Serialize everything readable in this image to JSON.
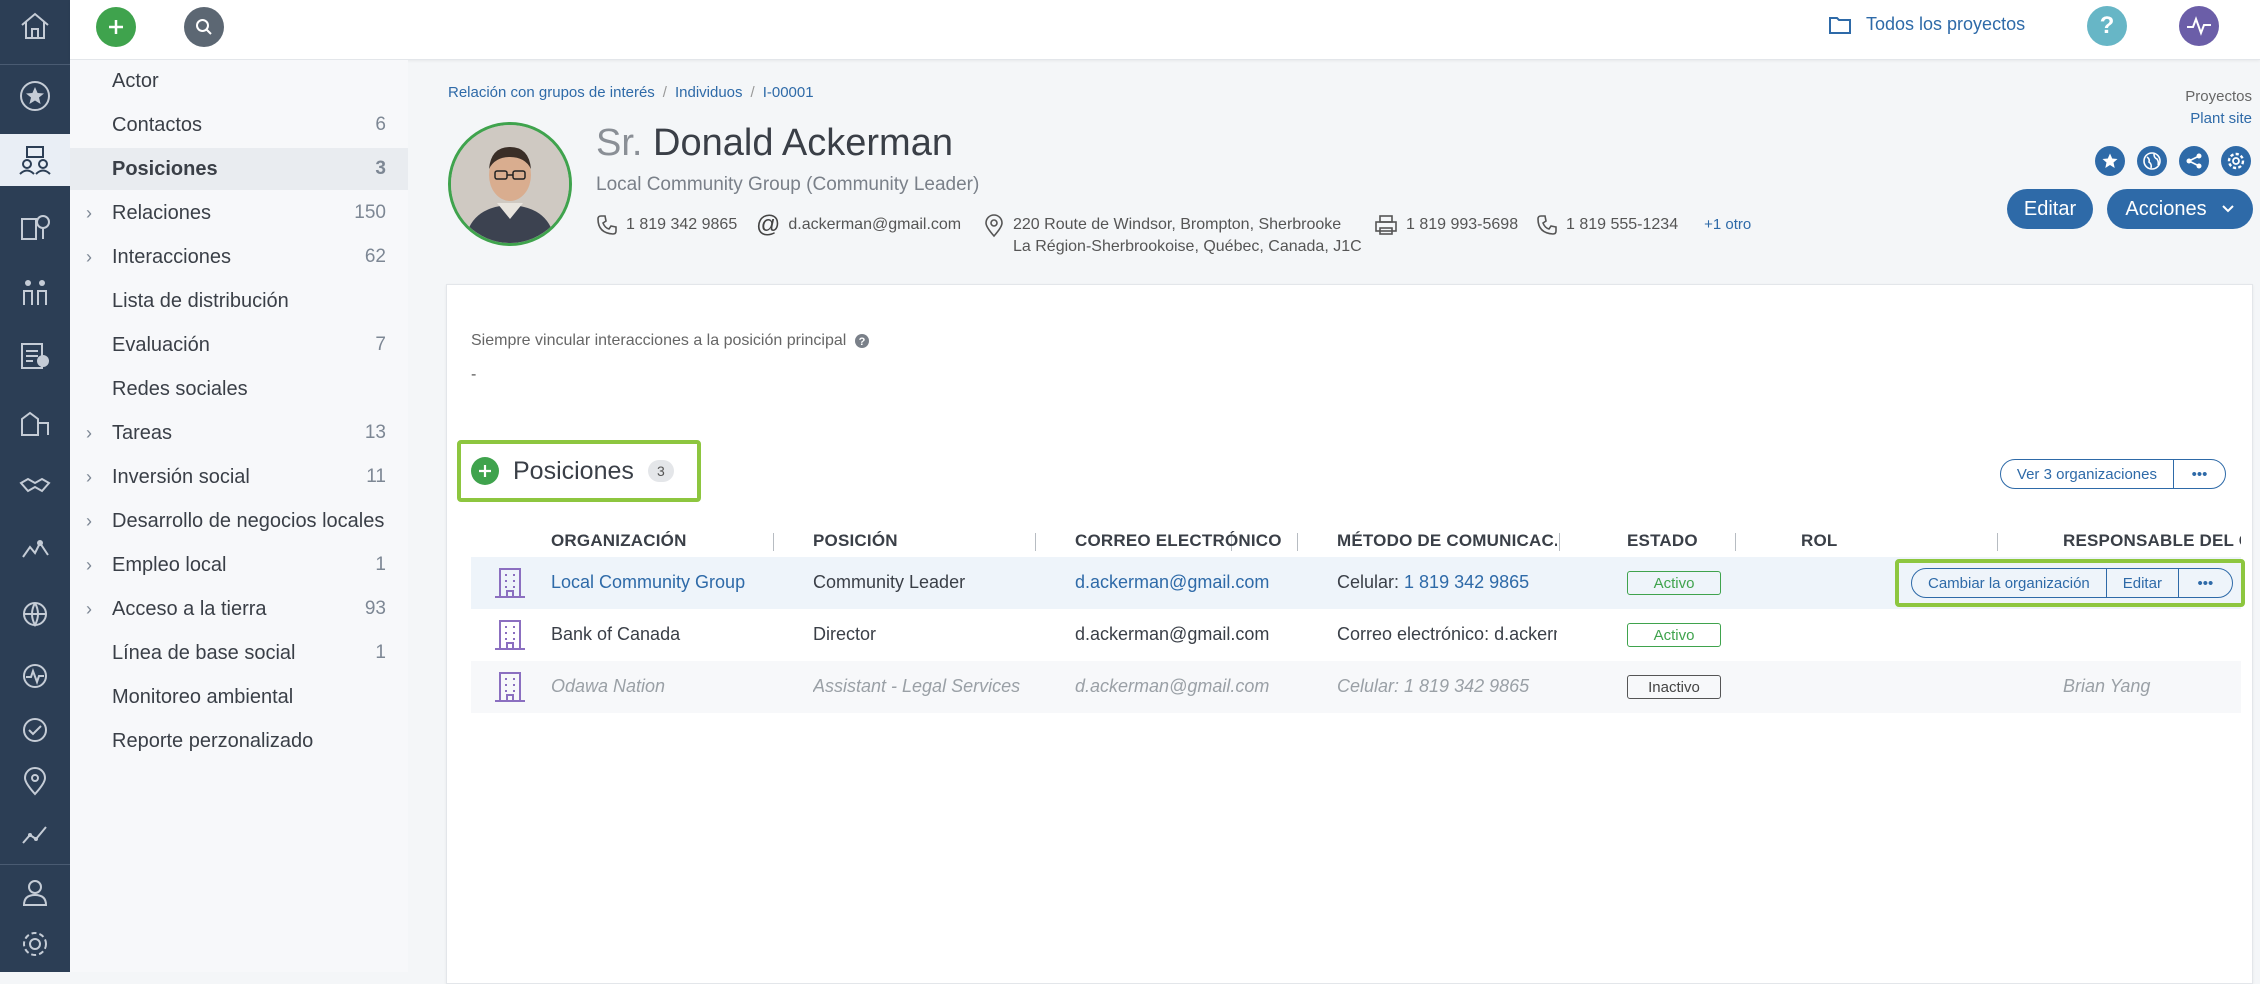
{
  "topbar": {
    "projects_label": "Todos los proyectos",
    "help_label": "?"
  },
  "leftnav": {
    "items": [
      {
        "label": "Actor",
        "count": "",
        "chevron": false,
        "active": false
      },
      {
        "label": "Contactos",
        "count": "6",
        "chevron": false,
        "active": false
      },
      {
        "label": "Posiciones",
        "count": "3",
        "chevron": false,
        "active": true
      },
      {
        "label": "Relaciones",
        "count": "150",
        "chevron": true,
        "active": false
      },
      {
        "label": "Interacciones",
        "count": "62",
        "chevron": true,
        "active": false
      },
      {
        "label": "Lista de distribución",
        "count": "",
        "chevron": false,
        "active": false
      },
      {
        "label": "Evaluación",
        "count": "7",
        "chevron": false,
        "active": false
      },
      {
        "label": "Redes sociales",
        "count": "",
        "chevron": false,
        "active": false
      },
      {
        "label": "Tareas",
        "count": "13",
        "chevron": true,
        "active": false
      },
      {
        "label": "Inversión social",
        "count": "11",
        "chevron": true,
        "active": false
      },
      {
        "label": "Desarrollo de negocios locales",
        "count": "",
        "chevron": true,
        "active": false
      },
      {
        "label": "Empleo local",
        "count": "1",
        "chevron": true,
        "active": false
      },
      {
        "label": "Acceso a la tierra",
        "count": "93",
        "chevron": true,
        "active": false
      },
      {
        "label": "Línea de base social",
        "count": "1",
        "chevron": false,
        "active": false
      },
      {
        "label": "Monitoreo ambiental",
        "count": "",
        "chevron": false,
        "active": false
      },
      {
        "label": "Reporte perzonalizado",
        "count": "",
        "chevron": false,
        "active": false
      }
    ]
  },
  "breadcrumb": {
    "items": [
      "Relación con grupos de interés",
      "Individuos",
      "I-00001"
    ]
  },
  "project": {
    "label": "Proyectos",
    "value": "Plant site"
  },
  "profile": {
    "honorific": "Sr.",
    "name": "Donald Ackerman",
    "subtitle": "Local Community Group (Community Leader)",
    "phone": "1 819 342 9865",
    "email": "d.ackerman@gmail.com",
    "address_line1": "220 Route de Windsor, Brompton, Sherbrooke",
    "address_line2": "La Région-Sherbrookoise, Québec, Canada, J1C",
    "fax": "1 819 993-5698",
    "phone2": "1 819 555-1234",
    "more": "+1 otro"
  },
  "actions": {
    "edit_label": "Editar",
    "actions_label": "Acciones"
  },
  "setting": {
    "label": "Siempre vincular interacciones a la posición principal",
    "value": "-"
  },
  "positions": {
    "title": "Posiciones",
    "count": "3",
    "view_orgs_label": "Ver 3 organizaciones",
    "more_label": "•••",
    "columns": [
      "ORGANIZACIÓN",
      "POSICIÓN",
      "CORREO ELECTRÓNICO",
      "MÉTODO DE COMUNICAC...",
      "ESTADO",
      "ROL",
      "RESPONSABLE DEL CO"
    ],
    "rows": [
      {
        "org": "Local Community Group",
        "position": "Community Leader",
        "email": "d.ackerman@gmail.com",
        "method_prefix": "Celular: ",
        "method_value": "1 819 342 9865",
        "status": "Activo",
        "role": "",
        "owner": ""
      },
      {
        "org": "Bank of Canada",
        "position": "Director",
        "email": "d.ackerman@gmail.com",
        "method_prefix": "Correo electrónico: d.ackerm...",
        "method_value": "",
        "status": "Activo",
        "role": "",
        "owner": ""
      },
      {
        "org": "Odawa Nation",
        "position": "Assistant - Legal Services",
        "email": "d.ackerman@gmail.com",
        "method_prefix": "Celular: 1 819 342 9865",
        "method_value": "",
        "status": "Inactivo",
        "role": "",
        "owner": "Brian Yang"
      }
    ],
    "row_actions": {
      "change_org_label": "Cambiar la organización",
      "edit_label": "Editar",
      "more_label": "•••"
    }
  },
  "colors": {
    "rail": "#2c3e55",
    "accent": "#2e6aa8",
    "green": "#3fa34d",
    "highlight": "#8dc63f"
  }
}
